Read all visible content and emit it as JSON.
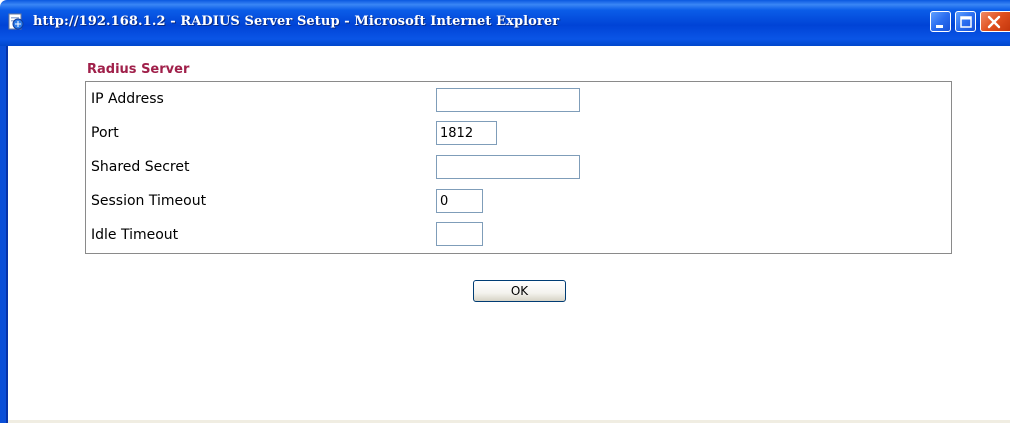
{
  "window": {
    "title": "http://192.168.1.2 - RADIUS Server Setup - Microsoft Internet Explorer",
    "icon": "ie-page-icon",
    "controls": [
      "minimize-icon",
      "maximize-icon",
      "close-icon"
    ]
  },
  "section": {
    "title": "Radius Server"
  },
  "form": {
    "ip_address": {
      "label": "IP Address",
      "value": ""
    },
    "port": {
      "label": "Port",
      "value": "1812"
    },
    "shared_secret": {
      "label": "Shared Secret",
      "value": ""
    },
    "session_timeout": {
      "label": "Session Timeout",
      "value": "0"
    },
    "idle_timeout": {
      "label": "Idle Timeout",
      "value": ""
    }
  },
  "actions": {
    "ok_label": "OK"
  },
  "colors": {
    "titlebar": "#0a55e6",
    "section_title": "#a0204a",
    "field_border": "#7f9db9"
  }
}
